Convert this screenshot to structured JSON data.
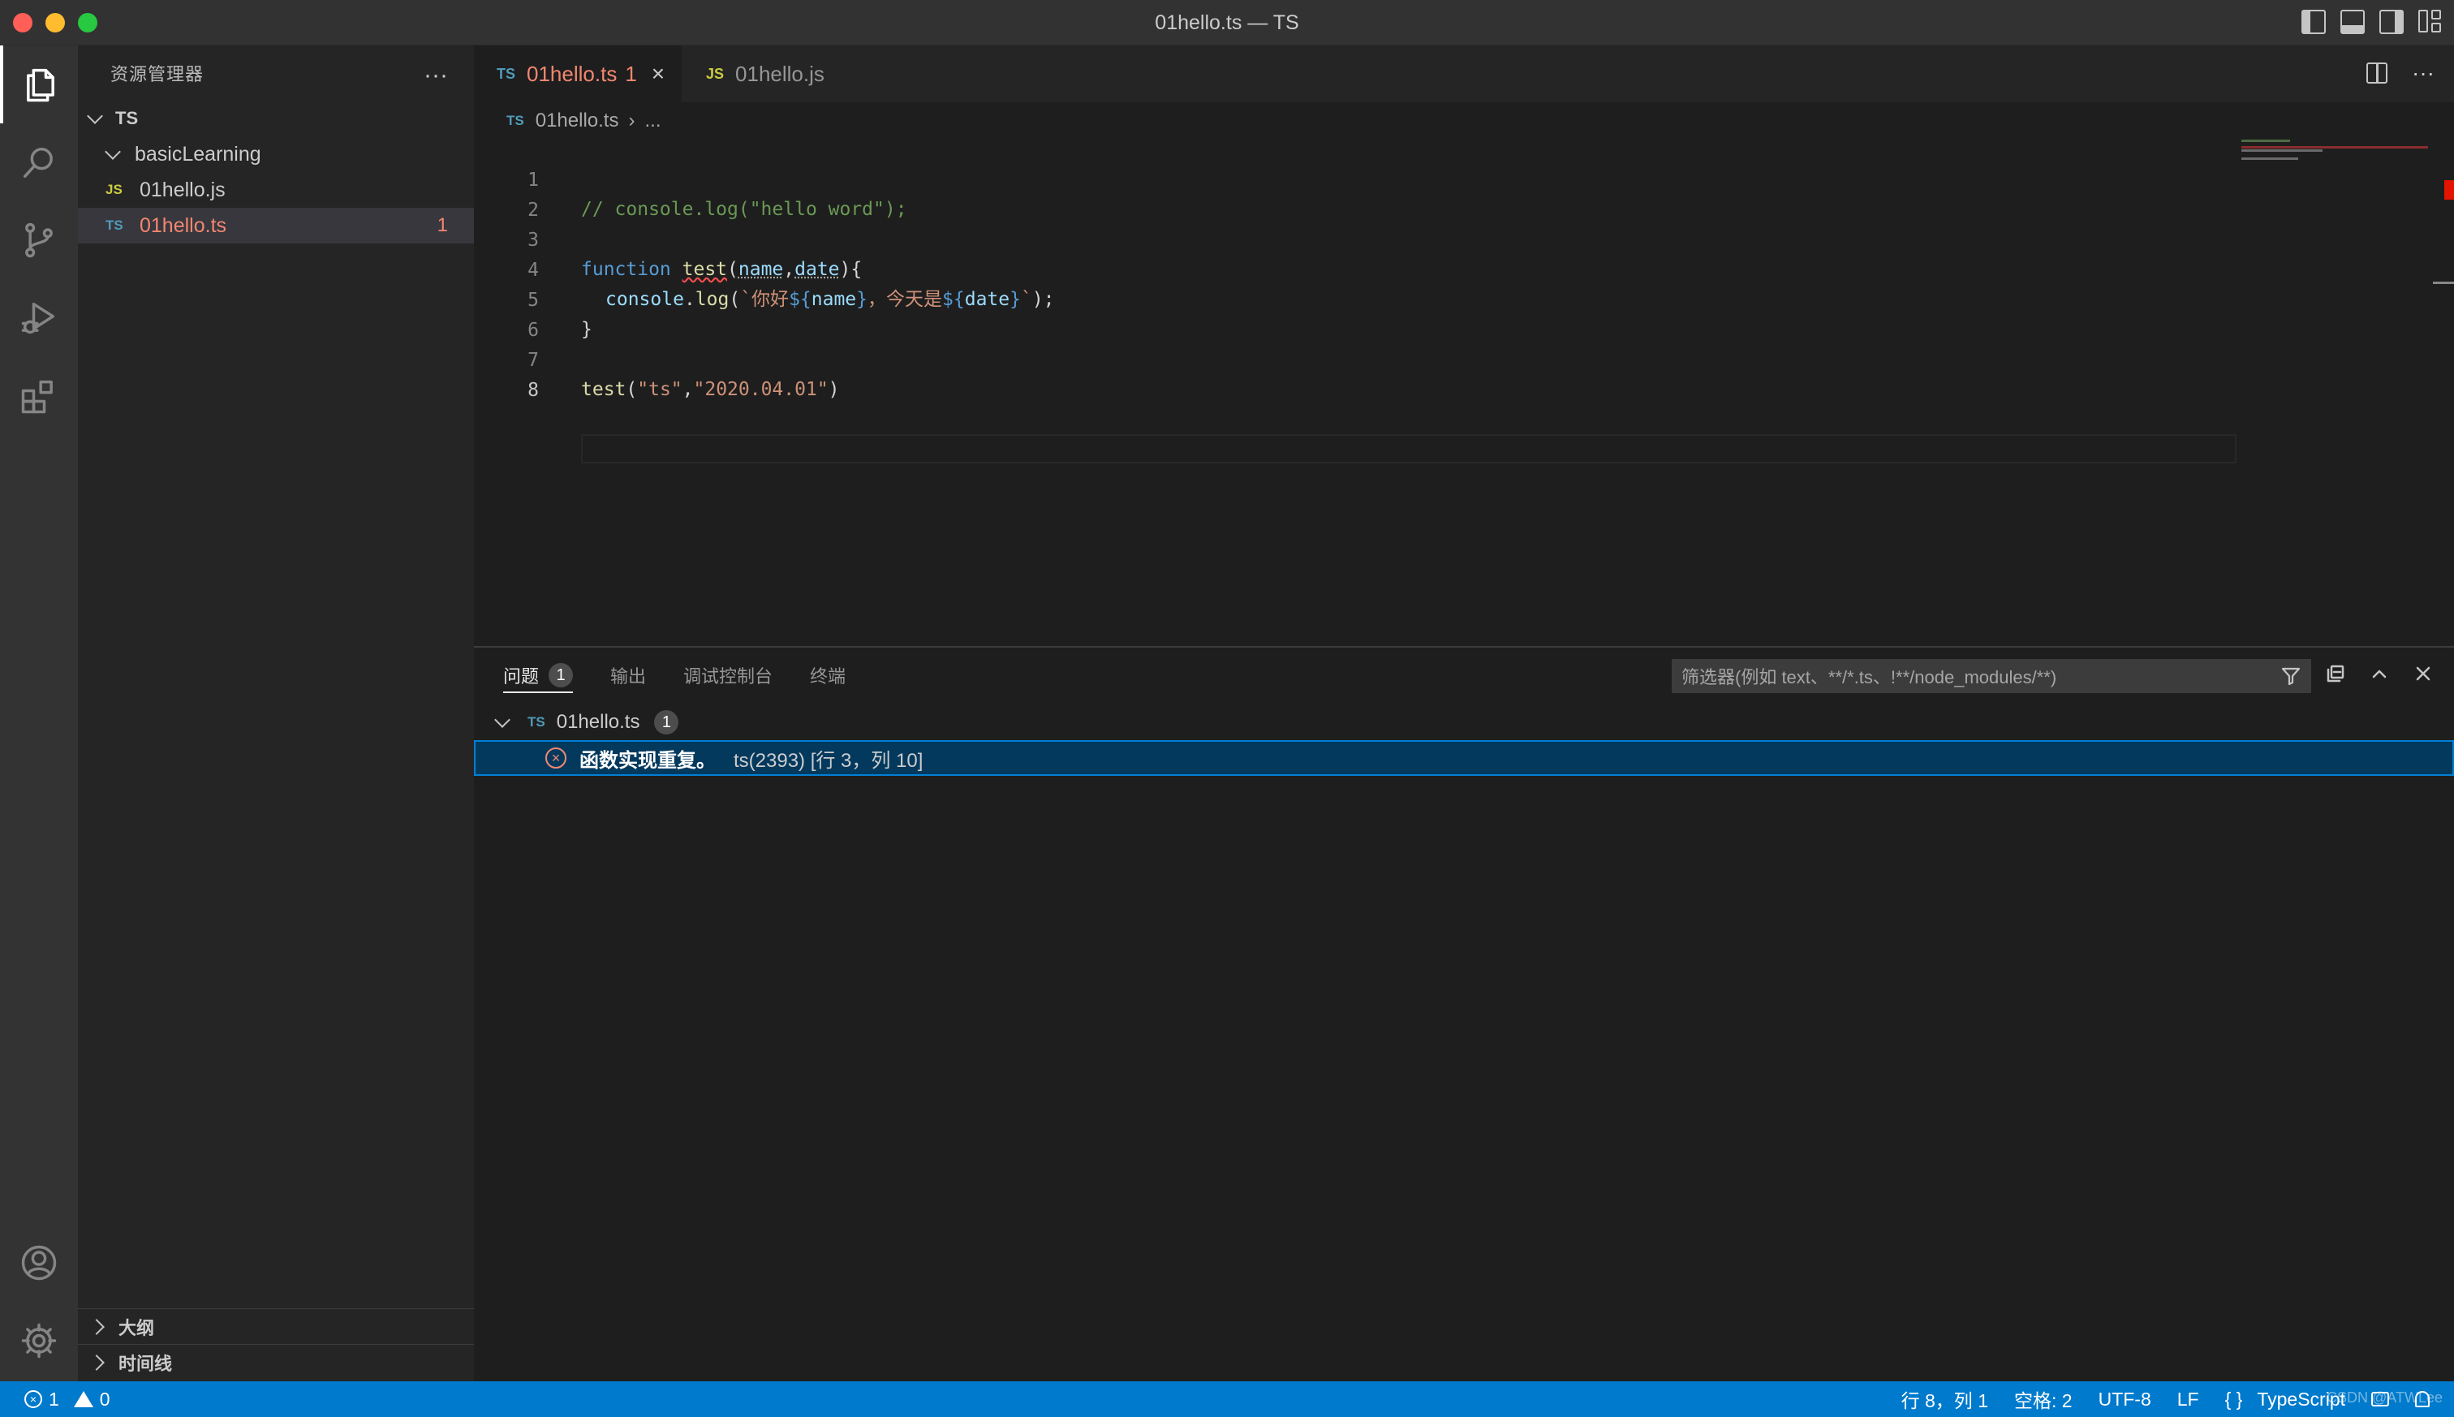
{
  "window": {
    "title": "01hello.ts — TS"
  },
  "sidebar": {
    "header": "资源管理器",
    "more": "···",
    "root": "TS",
    "folder": "basicLearning",
    "files": [
      {
        "badge": "JS",
        "name": "01hello.js",
        "errors": ""
      },
      {
        "badge": "TS",
        "name": "01hello.ts",
        "errors": "1"
      }
    ],
    "sections": [
      "大纲",
      "时间线"
    ]
  },
  "tabs": [
    {
      "badge": "TS",
      "label": "01hello.ts",
      "errors": "1",
      "close": "×"
    },
    {
      "badge": "JS",
      "label": "01hello.js"
    }
  ],
  "breadcrumb": {
    "badge": "TS",
    "file": "01hello.ts",
    "rest": "..."
  },
  "code": {
    "line_numbers": [
      "1",
      "2",
      "3",
      "4",
      "5",
      "6",
      "7",
      "8"
    ],
    "line1": "// console.log(\"hello word\");",
    "l3_kw": "function",
    "l3_fn": "test",
    "l3_open": "(",
    "l3_p1": "name",
    "l3_comma": ",",
    "l3_p2": "date",
    "l3_close": "){",
    "l4_obj": "console",
    "l4_dot": ".",
    "l4_fn": "log",
    "l4_open": "(",
    "l4_str1": "`你好",
    "l4_tpl1o": "${",
    "l4_v1": "name",
    "l4_tpl1c": "}",
    "l4_str2": "，今天是",
    "l4_tpl2o": "${",
    "l4_v2": "date",
    "l4_tpl2c": "}",
    "l4_str3": "`",
    "l4_close": ");",
    "l5": "}",
    "l7_fn": "test",
    "l7_open": "(",
    "l7_s1": "\"ts\"",
    "l7_comma": ",",
    "l7_s2": "\"2020.04.01\"",
    "l7_close": ")"
  },
  "panel": {
    "tabs": [
      {
        "label": "问题",
        "count": "1"
      },
      {
        "label": "输出"
      },
      {
        "label": "调试控制台"
      },
      {
        "label": "终端"
      }
    ],
    "filter_placeholder": "筛选器(例如 text、**/*.ts、!**/node_modules/**)",
    "group": {
      "badge": "TS",
      "file": "01hello.ts",
      "count": "1"
    },
    "problem": {
      "icon": "×",
      "message": "函数实现重复。",
      "source": "ts(2393)  [行 3，列 10]"
    }
  },
  "statusbar": {
    "errors": "1",
    "warnings": "0",
    "position": "行 8，列 1",
    "spaces": "空格: 2",
    "encoding": "UTF-8",
    "eol": "LF",
    "language_icon": "{ }",
    "language": "TypeScript",
    "watermark": "CSDN @ATWLee"
  },
  "colors": {
    "accent": "#007acc",
    "error": "#f48771",
    "ts_badge": "#519aba",
    "js_badge": "#cbcb41"
  }
}
